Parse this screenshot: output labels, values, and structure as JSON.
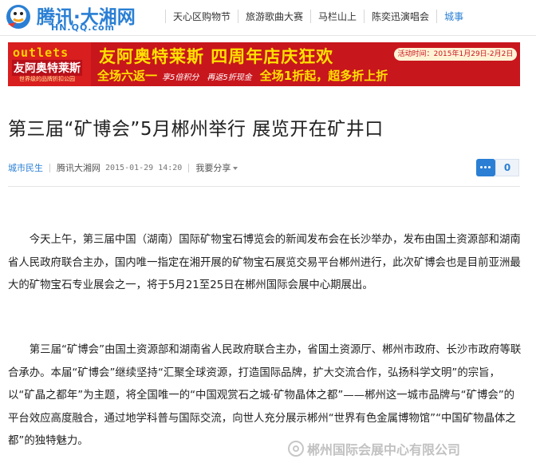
{
  "header": {
    "logo_text": "腾讯·大湘网",
    "logo_sub": "HN.QQ.com",
    "nav": [
      "天心区购物节",
      "旅游歌曲大赛",
      "马栏山上",
      "陈奕迅演唱会",
      "城事"
    ]
  },
  "banner": {
    "brand_en": "outlets",
    "brand_cn": "友阿奥特莱斯",
    "brand_tagline": "世界级的品牌折扣公园",
    "title": "友阿奥特莱斯 四周年店庆狂欢",
    "date": "活动时间：2015年1月29日-2月2日",
    "promos": [
      {
        "main": "全场六返一",
        "sub": "享5倍积分"
      },
      {
        "main": "",
        "sub": "再返5折现金"
      },
      {
        "main": "全场1折起，超多折上折",
        "sub": ""
      }
    ]
  },
  "article": {
    "title": "第三届“矿博会”5月郴州举行 展览开在矿井口",
    "category": "城市民生",
    "source": "腾讯大湘网",
    "time": "2015-01-29 14:20",
    "share": "我要分享",
    "comment_count": "0",
    "paragraphs": [
      "今天上午，第三届中国（湖南）国际矿物宝石博览会的新闻发布会在长沙举办，发布由国土资源部和湖南省人民政府联合主办，国内唯一指定在湘开展的矿物宝石展览交易平台郴州进行，此次矿博会也是目前亚洲最大的矿物宝石专业展会之一，将于5月21至25日在郴州国际会展中心期展出。",
      "第三届“矿博会”由国土资源部和湖南省人民政府联合主办，省国土资源厅、郴州市政府、长沙市政府等联合承办。本届“矿博会”继续坚持“汇聚全球资源，打造国际品牌，扩大交流合作，弘扬科学文明”的宗旨，以“矿晶之都年”为主题，将全国唯一的“中国观赏石之城·矿物晶体之都”——郴州这一城市品牌与“矿博会”的平台效应高度融合，通过地学科普与国际交流，向世人充分展示郴州“世界有色金属博物馆”“中国矿物晶体之都”的独特魅力。"
    ]
  },
  "watermark": {
    "text": "郴州国际会展中心有限公司"
  },
  "colors": {
    "link_blue": "#2a7fd4",
    "banner_red": "#c8161d",
    "banner_yellow": "#ffe100"
  }
}
